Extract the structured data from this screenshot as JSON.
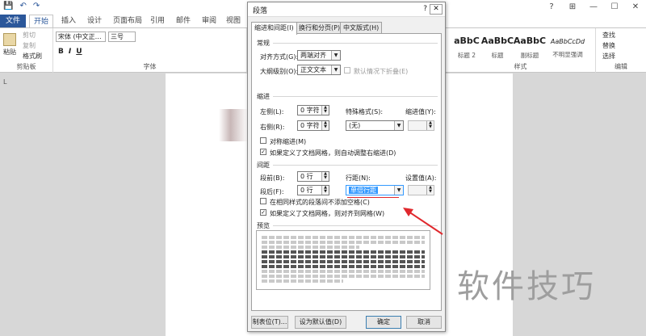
{
  "colors": {
    "accent": "#2b579a",
    "highlight": "#3399ff",
    "annotation": "#e0282d"
  },
  "word": {
    "qat": [
      "💾",
      "↶",
      "↷"
    ],
    "window_controls": [
      "?",
      "⊞",
      "—",
      "☐",
      "✕"
    ],
    "tabs": [
      "文件",
      "开始",
      "插入",
      "设计",
      "页面布局",
      "引用",
      "邮件",
      "审阅",
      "视图"
    ],
    "clipboard": {
      "paste": "粘贴",
      "cut": "剪切",
      "copy": "复制",
      "painter": "格式刷",
      "label": "剪贴板"
    },
    "font": {
      "name": "宋体 (中文正…",
      "size": "三号",
      "label": "字体",
      "bold": "B",
      "italic": "I",
      "underline": "U"
    },
    "styles": {
      "label": "样式",
      "items": [
        {
          "sample": "aBbC",
          "name": "标题 2"
        },
        {
          "sample": "AaBbC",
          "name": "标题"
        },
        {
          "sample": "AaBbC",
          "name": "副标题"
        },
        {
          "sample": "AaBbCcDd",
          "name": "不明显强调"
        }
      ]
    },
    "editing": {
      "find": "查找",
      "replace": "替换",
      "select": "选择",
      "label": "编辑"
    },
    "ruler": "L",
    "watermark": "软件技巧"
  },
  "dialog": {
    "title": "段落",
    "help": "?",
    "close": "✕",
    "tabs": [
      "缩进和间距(I)",
      "换行和分页(P)",
      "中文版式(H)"
    ],
    "general": {
      "section": "常规",
      "alignment_label": "对齐方式(G):",
      "alignment_value": "两端对齐",
      "outline_label": "大纲级别(O):",
      "outline_value": "正文文本",
      "collapse_label": "默认情况下折叠(E)"
    },
    "indent": {
      "section": "缩进",
      "left_label": "左侧(L):",
      "left_value": "0 字符",
      "right_label": "右侧(R):",
      "right_value": "0 字符",
      "special_label": "特殊格式(S):",
      "special_value": "(无)",
      "indent_by_label": "缩进值(Y):",
      "mirror_label": "对称缩进(M)",
      "auto_adjust_label": "如果定义了文档网格，则自动调整右缩进(D)"
    },
    "spacing": {
      "section": "间距",
      "before_label": "段前(B):",
      "before_value": "0 行",
      "after_label": "段后(F):",
      "after_value": "0 行",
      "line_label": "行距(N):",
      "line_value": "单倍行距",
      "at_label": "设置值(A):",
      "no_space_label": "在相同样式的段落间不添加空格(C)",
      "snap_label": "如果定义了文档网格，则对齐到网格(W)"
    },
    "preview": {
      "section": "预览"
    },
    "buttons": {
      "tabs": "制表位(T)...",
      "default": "设为默认值(D)",
      "ok": "确定",
      "cancel": "取消"
    }
  }
}
